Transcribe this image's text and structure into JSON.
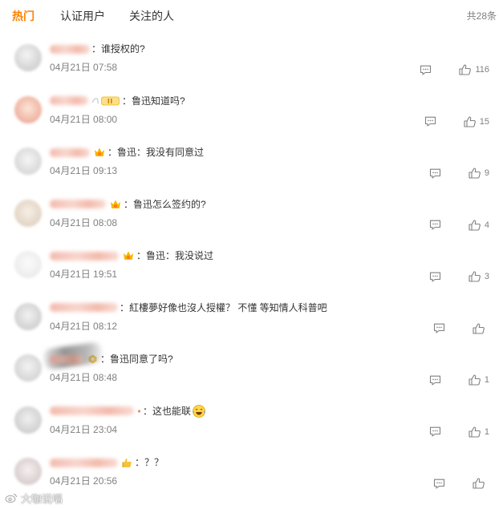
{
  "tabs": [
    {
      "label": "热门",
      "active": true
    },
    {
      "label": "认证用户",
      "active": false
    },
    {
      "label": "关注的人",
      "active": false
    }
  ],
  "total": "共28条",
  "colors": {
    "accent": "#ff8200",
    "text": "#333333",
    "meta": "#808080",
    "username": "#eb7350"
  },
  "icons": {
    "reply": "comment-icon",
    "like": "thumbs-up-icon"
  },
  "comments": [
    {
      "text": "：谁授权的?",
      "date": "04月21日 07:58",
      "likes": "116",
      "badge_icon": null
    },
    {
      "text": "：鲁迅知道吗?",
      "date": "04月21日 08:00",
      "likes": "15",
      "badge_icon": "member-badge-icon"
    },
    {
      "text": "：鲁迅：我没有同意过",
      "date": "04月21日 09:13",
      "likes": "9",
      "badge_icon": "crown-icon"
    },
    {
      "text": "：鲁迅怎么签约的?",
      "date": "04月21日 08:08",
      "likes": "4",
      "badge_icon": "crown-icon"
    },
    {
      "text": "：鲁迅：我没说过",
      "date": "04月21日 19:51",
      "likes": "3",
      "badge_icon": "crown-icon"
    },
    {
      "text": "：紅樓夢好像也沒人授權？ 不懂 等知情人科普吧",
      "date": "04月21日 08:12",
      "likes": null,
      "badge_icon": null
    },
    {
      "text": "：鲁迅同意了吗?",
      "date": "04月21日 08:48",
      "likes": "1",
      "badge_icon": "fan-badge-icon"
    },
    {
      "text": "：这也能联",
      "emoji": "laugh-cry-emoji-icon",
      "date": "04月21日 23:04",
      "likes": "1",
      "badge_icon": "dot-badge-icon"
    },
    {
      "text": "：？？",
      "date": "04月21日 20:56",
      "likes": null,
      "badge_icon": "hand-badge-icon"
    }
  ],
  "watermark": "大咖说唱"
}
